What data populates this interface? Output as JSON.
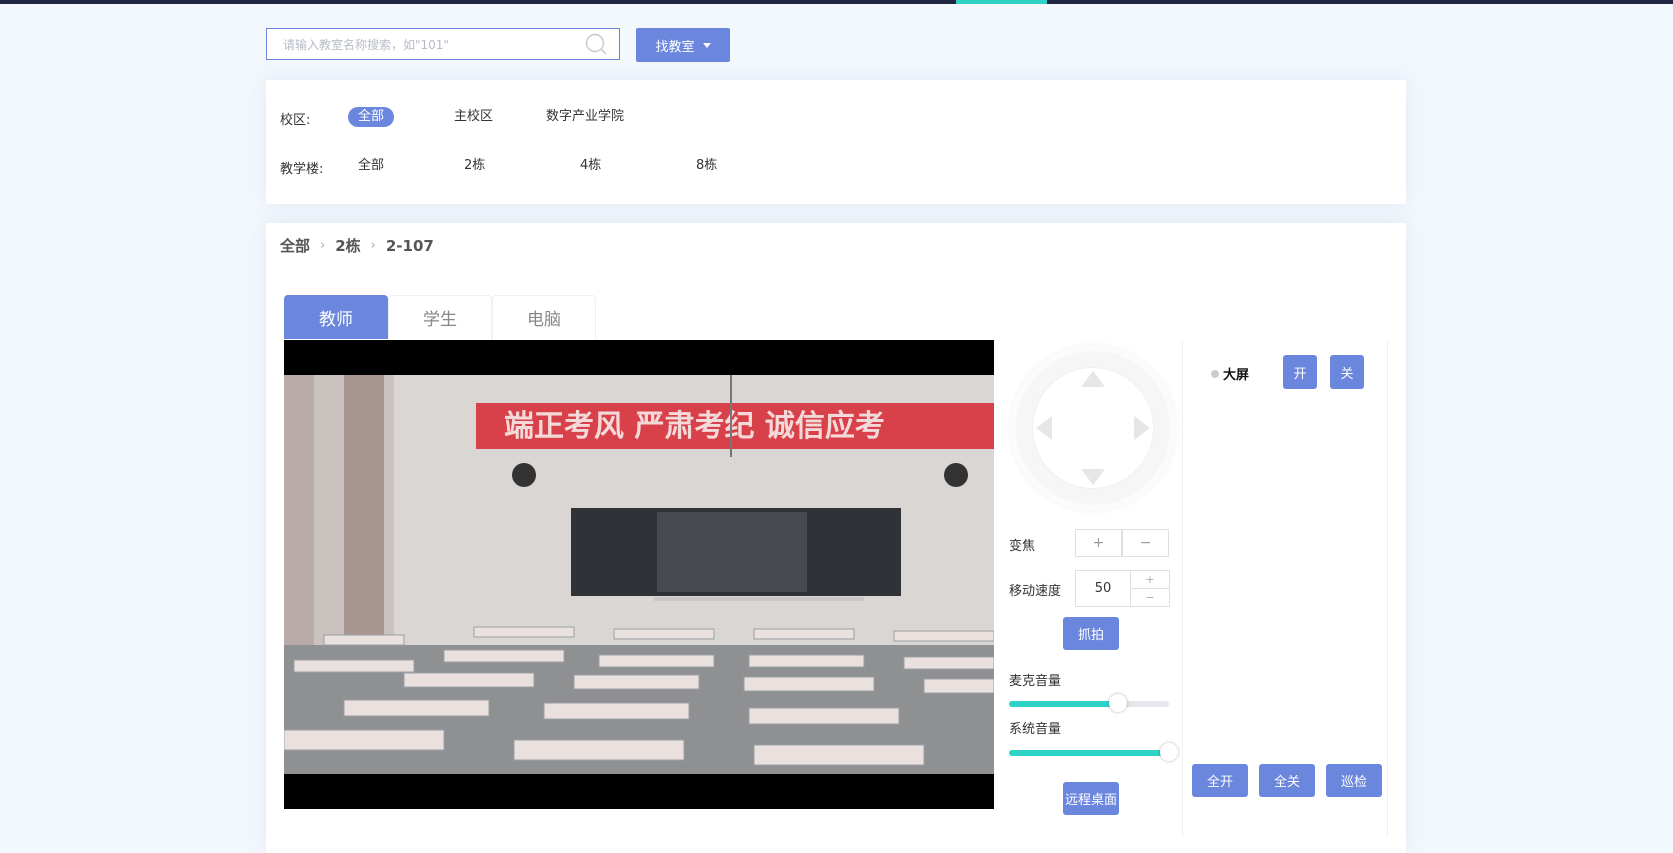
{
  "search": {
    "placeholder": "请输入教室名称搜索，如\"101\"",
    "value": "",
    "find_label": "找教室"
  },
  "filters": {
    "campus_label": "校区:",
    "campus_options": [
      "全部",
      "主校区",
      "数字产业学院"
    ],
    "campus_selected": "全部",
    "building_label": "教学楼:",
    "building_options": [
      "全部",
      "2栋",
      "4栋",
      "8栋"
    ]
  },
  "breadcrumb": [
    "全部",
    "2栋",
    "2-107"
  ],
  "tabs": [
    {
      "label": "教师",
      "active": true
    },
    {
      "label": "学生",
      "active": false
    },
    {
      "label": "电脑",
      "active": false
    }
  ],
  "video": {
    "banner_text": "端正考风  严肃考纪  诚信应考"
  },
  "controls": {
    "zoom_label": "变焦",
    "zoom_in": "+",
    "zoom_out": "−",
    "speed_label": "移动速度",
    "speed_value": "50",
    "speed_up": "+",
    "speed_down": "−",
    "snapshot_label": "抓拍",
    "mic_label": "麦克音量",
    "mic_level": 0.68,
    "sys_label": "系统音量",
    "sys_level": 1.0,
    "remote_label": "远程桌面"
  },
  "devices": {
    "screen_label": "大屏",
    "on_label": "开",
    "off_label": "关",
    "all_on_label": "全开",
    "all_off_label": "全关",
    "patrol_label": "巡检"
  },
  "colors": {
    "accent": "#6b86dd",
    "teal": "#2ed3c6",
    "topbar": "#1f2742"
  }
}
